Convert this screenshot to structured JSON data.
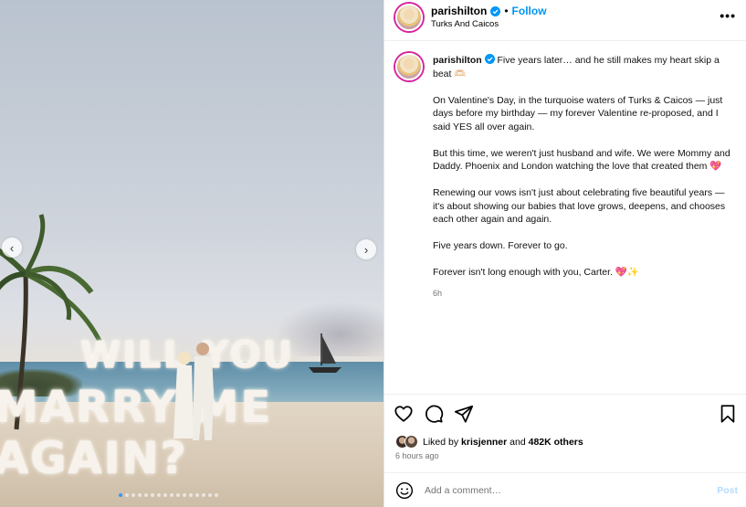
{
  "post": {
    "username": "parishilton",
    "follow_label": "Follow",
    "separator": "•",
    "location": "Turks And Caicos",
    "more_label": "•••"
  },
  "photo": {
    "sign_row1": "WILL YOU",
    "sign_row2": "MARRY ME AGAIN?",
    "prev_label": "‹",
    "next_label": "›",
    "dot_count": 16,
    "active_dot": 0
  },
  "caption": {
    "username": "parishilton",
    "line1": "Five years later… and he still makes my heart skip a beat 🫶🏻",
    "para2": "On Valentine's Day, in the turquoise waters of Turks & Caicos — just days before my birthday — my forever Valentine re-proposed, and I said YES all over again.",
    "para3": "But this time, we weren't just husband and wife. We were Mommy and Daddy. Phoenix and London watching the love that created them 💖",
    "para4": "Renewing our vows isn't just about celebrating five beautiful years — it's about showing our babies that love grows, deepens, and chooses each other again and again.",
    "para5": "Five years down. Forever to go.",
    "para6": "Forever isn't long enough with you, Carter. 💖✨",
    "time": "6h"
  },
  "engagement": {
    "liked_by_prefix": "Liked by",
    "liked_by_user": "krisjenner",
    "and_label": "and",
    "others": "482K others",
    "posted_ago": "6 hours ago"
  },
  "comment": {
    "placeholder": "Add a comment…",
    "post_label": "Post"
  },
  "icons": [
    "verified-badge-icon",
    "more-options-icon",
    "heart-icon",
    "comment-icon",
    "share-icon",
    "bookmark-icon",
    "emoji-icon",
    "chevron-left-icon",
    "chevron-right-icon"
  ],
  "colors": {
    "accent": "#0095f6",
    "post_disabled": "#b3dbff",
    "muted": "#737373",
    "verified": "#0095f6"
  }
}
